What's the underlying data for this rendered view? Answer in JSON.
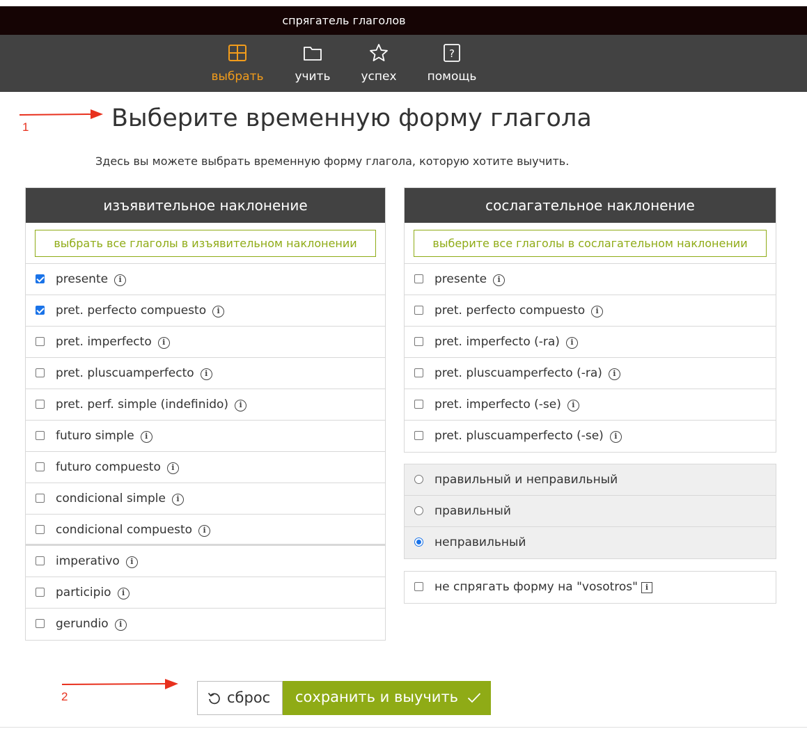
{
  "app": {
    "title": "спрягатель глаголов"
  },
  "nav": [
    {
      "label": "выбрать",
      "icon": "grid-icon",
      "active": true
    },
    {
      "label": "учить",
      "icon": "folder-icon",
      "active": false
    },
    {
      "label": "успех",
      "icon": "star-icon",
      "active": false
    },
    {
      "label": "помощь",
      "icon": "help-icon",
      "active": false
    }
  ],
  "annotations": {
    "step1": "1",
    "step2": "2",
    "arrow_color": "#e8311e"
  },
  "page": {
    "title": "Выберите временную форму глагола",
    "intro": "Здесь вы можете выбрать временную форму глагола, которую хотите выучить."
  },
  "indicative": {
    "heading": "изъявительное наклонение",
    "select_all": "выбрать все глаголы в изъявительном наклонении",
    "items": [
      {
        "label": "presente",
        "checked": true
      },
      {
        "label": "pret. perfecto compuesto",
        "checked": true
      },
      {
        "label": "pret. imperfecto",
        "checked": false
      },
      {
        "label": "pret. pluscuamperfecto",
        "checked": false
      },
      {
        "label": "pret. perf. simple (indefinido)",
        "checked": false
      },
      {
        "label": "futuro simple",
        "checked": false
      },
      {
        "label": "futuro compuesto",
        "checked": false
      },
      {
        "label": "condicional simple",
        "checked": false
      },
      {
        "label": "condicional compuesto",
        "checked": false
      },
      {
        "label": "imperativo",
        "checked": false
      },
      {
        "label": "participio",
        "checked": false
      },
      {
        "label": "gerundio",
        "checked": false
      }
    ]
  },
  "subjunctive": {
    "heading": "сослагательное наклонение",
    "select_all": "выберите все глаголы в сослагательном наклонении",
    "items": [
      {
        "label": "presente",
        "checked": false
      },
      {
        "label": "pret. perfecto compuesto",
        "checked": false
      },
      {
        "label": "pret. imperfecto (-ra)",
        "checked": false
      },
      {
        "label": "pret. pluscuamperfecto (-ra)",
        "checked": false
      },
      {
        "label": "pret. imperfecto (-se)",
        "checked": false
      },
      {
        "label": "pret. pluscuamperfecto (-se)",
        "checked": false
      }
    ]
  },
  "verb_type": {
    "options": [
      {
        "label": "правильный и неправильный",
        "selected": false
      },
      {
        "label": "правильный",
        "selected": false
      },
      {
        "label": "неправильный",
        "selected": true
      }
    ]
  },
  "vosotros": {
    "label": "не спрягать форму на \"vosotros\"",
    "checked": false
  },
  "buttons": {
    "reset": "сброс",
    "save": "сохранить и выучить"
  },
  "colors": {
    "accent_orange": "#f29c1b",
    "accent_green": "#8fab16",
    "nav_bg": "#424242",
    "topbar_bg": "#150404"
  }
}
